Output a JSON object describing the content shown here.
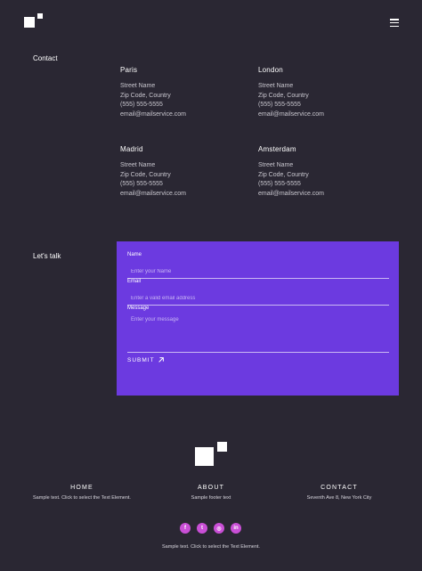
{
  "header": {
    "menu_icon": "hamburger-icon"
  },
  "contact": {
    "label": "Contact",
    "offices": [
      {
        "city": "Paris",
        "street": "Street Name",
        "zip": "Zip Code, Country",
        "phone": "(555) 555-5555",
        "email": "email@mailservice.com"
      },
      {
        "city": "London",
        "street": "Street Name",
        "zip": "Zip Code, Country",
        "phone": "(555) 555-5555",
        "email": "email@mailservice.com"
      },
      {
        "city": "Madrid",
        "street": "Street Name",
        "zip": "Zip Code, Country",
        "phone": "(555) 555-5555",
        "email": "email@mailservice.com"
      },
      {
        "city": "Amsterdam",
        "street": "Street Name",
        "zip": "Zip Code, Country",
        "phone": "(555) 555-5555",
        "email": "email@mailservice.com"
      }
    ]
  },
  "talk": {
    "label": "Let's talk",
    "name_label": "Name",
    "name_placeholder": "Enter your Name",
    "email_label": "Email",
    "email_placeholder": "Enter a valid email address",
    "message_label": "Message",
    "message_placeholder": "Enter your message",
    "submit_label": "SUBMIT",
    "card_color": "#6c3ae0"
  },
  "footer": {
    "columns": [
      {
        "title": "HOME",
        "text": "Sample text. Click to select the Text Element."
      },
      {
        "title": "ABOUT",
        "text": "Sample footer text"
      },
      {
        "title": "CONTACT",
        "text": "Seventh Ave 8, New York City"
      }
    ],
    "social": [
      {
        "icon": "facebook-icon",
        "glyph": "f"
      },
      {
        "icon": "twitter-icon",
        "glyph": "t"
      },
      {
        "icon": "instagram-icon",
        "glyph": "◎"
      },
      {
        "icon": "linkedin-icon",
        "glyph": "in"
      }
    ],
    "bottom_text": "Sample text. Click to select the Text Element.",
    "social_color": "#c94fd6"
  },
  "colors": {
    "background": "#2a2733",
    "accent": "#6c3ae0"
  }
}
